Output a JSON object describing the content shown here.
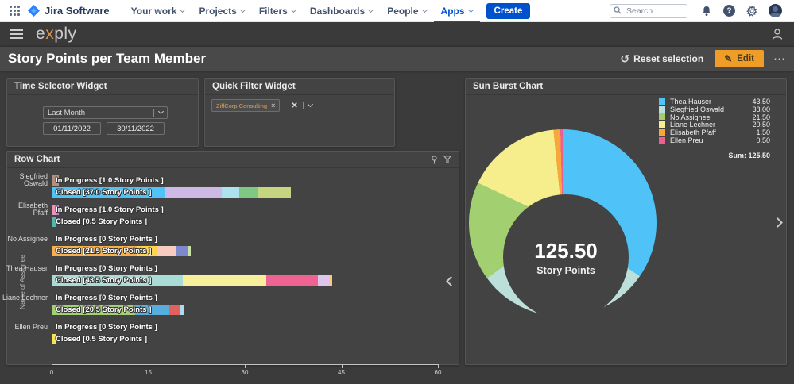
{
  "icons": {
    "more": "⋯",
    "undo": "↺",
    "pencil": "✎",
    "clear": "✕",
    "chip_close": "×",
    "help": "?"
  },
  "nav": {
    "brand": "Jira Software",
    "menus": [
      {
        "label": "Your work"
      },
      {
        "label": "Projects"
      },
      {
        "label": "Filters"
      },
      {
        "label": "Dashboards"
      },
      {
        "label": "People"
      },
      {
        "label": "Apps",
        "active": true
      }
    ],
    "create_label": "Create",
    "search_placeholder": "Search"
  },
  "appbar": {
    "logo_e": "e",
    "logo_x": "x",
    "logo_rest": "ply"
  },
  "titlebar": {
    "title": "Story Points per Team Member",
    "reset_label": "Reset selection",
    "edit_label": "Edit"
  },
  "widgets": {
    "time_selector": {
      "title": "Time Selector Widget",
      "range_value": "Last Month",
      "date_from": "01/11/2022",
      "date_to": "30/11/2022"
    },
    "quick_filter": {
      "title": "Quick Filter Widget",
      "chip_label": "ZiffCorp Consulting"
    }
  },
  "chart_data": [
    {
      "type": "bar",
      "title": "Row Chart",
      "orientation": "horizontal",
      "xlabel": "",
      "ylabel": "Name of Assignee",
      "xlim": [
        0,
        60
      ],
      "xticks": [
        0,
        15,
        30,
        45,
        60
      ],
      "groups": [
        {
          "name": "Siegfried Oswald",
          "name_display": "Siegfried\nOswald",
          "bars": [
            {
              "label": "In Progress [1.0 Story Points ]",
              "total": 1.0,
              "segments": [
                {
                  "value": 1.0,
                  "color": "#b28f7f"
                }
              ]
            },
            {
              "label": "Closed [37.0 Story Points ]",
              "total": 37.0,
              "segments": [
                {
                  "value": 17.5,
                  "color": "#4fc3f7"
                },
                {
                  "value": 8.75,
                  "color": "#cdb9e6"
                },
                {
                  "value": 2.75,
                  "color": "#abe2ee"
                },
                {
                  "value": 3.0,
                  "color": "#7fc883"
                },
                {
                  "value": 5.0,
                  "color": "#c5d481"
                }
              ]
            }
          ]
        },
        {
          "name": "Elisabeth Pfaff",
          "name_display": "Elisabeth\nPfaff",
          "bars": [
            {
              "label": "In Progress [1.0 Story Points ]",
              "total": 1.0,
              "segments": [
                {
                  "value": 0.5,
                  "color": "#f291b5"
                },
                {
                  "value": 0.5,
                  "color": "#b97fd4"
                }
              ]
            },
            {
              "label": "Closed [0.5 Story Points ]",
              "total": 0.5,
              "segments": [
                {
                  "value": 0.5,
                  "color": "#52b8ac"
                }
              ]
            }
          ]
        },
        {
          "name": "No Assignee",
          "name_display": "No Assignee",
          "bars": [
            {
              "label": "In Progress [0 Story Points ]",
              "total": 0,
              "segments": []
            },
            {
              "label": "Closed [21.5 Story Points ]",
              "total": 21.5,
              "segments": [
                {
                  "value": 13.25,
                  "color": "#f8b04c"
                },
                {
                  "value": 3.0,
                  "color": "#fdd44e"
                },
                {
                  "value": 3.0,
                  "color": "#f8cbc2"
                },
                {
                  "value": 1.75,
                  "color": "#7e88cc"
                },
                {
                  "value": 0.5,
                  "color": "#c9e2a4"
                }
              ]
            }
          ]
        },
        {
          "name": "Thea Hauser",
          "name_display": "Thea Hauser",
          "bars": [
            {
              "label": "In Progress [0 Story Points ]",
              "total": 0,
              "segments": []
            },
            {
              "label": "Closed [43.5 Story Points ]",
              "total": 43.5,
              "segments": [
                {
                  "value": 20.25,
                  "color": "#a9dcd4"
                },
                {
                  "value": 13.0,
                  "color": "#f7ef9b"
                },
                {
                  "value": 8.0,
                  "color": "#ef6392"
                },
                {
                  "value": 1.75,
                  "color": "#ddc5eb"
                },
                {
                  "value": 0.5,
                  "color": "#fbc77e"
                }
              ]
            }
          ]
        },
        {
          "name": "Liane Lechner",
          "name_display": "Liane Lechner",
          "bars": [
            {
              "label": "In Progress [0 Story Points ]",
              "total": 0,
              "segments": []
            },
            {
              "label": "Closed [20.5 Story Points ]",
              "total": 20.5,
              "segments": [
                {
                  "value": 12.9,
                  "color": "#a3d072"
                },
                {
                  "value": 5.2,
                  "color": "#57ace0"
                },
                {
                  "value": 1.8,
                  "color": "#e2615c"
                },
                {
                  "value": 0.6,
                  "color": "#abdaf2"
                }
              ]
            }
          ]
        },
        {
          "name": "Ellen Preu",
          "name_display": "Ellen Preu",
          "bars": [
            {
              "label": "In Progress [0 Story Points ]",
              "total": 0,
              "segments": []
            },
            {
              "label": "Closed [0.5 Story Points ]",
              "total": 0.5,
              "segments": [
                {
                  "value": 0.5,
                  "color": "#f8e353"
                }
              ]
            }
          ]
        }
      ]
    },
    {
      "type": "pie",
      "title": "Sun Burst Chart",
      "donut": true,
      "center_value": "125.50",
      "center_label": "Story Points",
      "sum_label": "Sum: 125.50",
      "legend_position": "top-right",
      "slices": [
        {
          "name": "Thea Hauser",
          "value": 43.5,
          "display": "43.50",
          "color": "#4fc3f7"
        },
        {
          "name": "Siegfried Oswald",
          "value": 38.0,
          "display": "38.00",
          "color": "#bce0d9"
        },
        {
          "name": "No Assignee",
          "value": 21.5,
          "display": "21.50",
          "color": "#a2cf70"
        },
        {
          "name": "Liane Lechner",
          "value": 20.5,
          "display": "20.50",
          "color": "#f6ee8d"
        },
        {
          "name": "Elisabeth Pfaff",
          "value": 1.5,
          "display": "1.50",
          "color": "#f6a83a"
        },
        {
          "name": "Ellen Preu",
          "value": 0.5,
          "display": "0.50",
          "color": "#ee5e93"
        }
      ]
    }
  ]
}
